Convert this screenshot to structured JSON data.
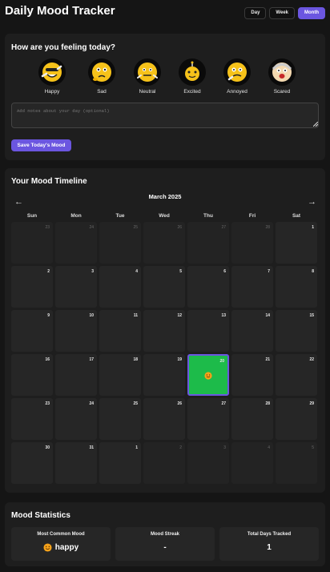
{
  "header": {
    "title": "Daily Mood Tracker",
    "views": [
      {
        "label": "Day",
        "active": false
      },
      {
        "label": "Week",
        "active": false
      },
      {
        "label": "Month",
        "active": true
      }
    ]
  },
  "entry": {
    "title": "How are you feeling today?",
    "moods": [
      {
        "label": "Happy",
        "icon": "happy-face-icon"
      },
      {
        "label": "Sad",
        "icon": "sad-face-icon"
      },
      {
        "label": "Neutral",
        "icon": "neutral-face-icon"
      },
      {
        "label": "Excited",
        "icon": "excited-face-icon"
      },
      {
        "label": "Annoyed",
        "icon": "annoyed-face-icon"
      },
      {
        "label": "Scared",
        "icon": "scared-face-icon"
      }
    ],
    "notes_placeholder": "Add notes about your day (optional)",
    "save_label": "Save Today's Mood"
  },
  "timeline": {
    "title": "Your Mood Timeline",
    "month": "March 2025",
    "prev_arrow": "←",
    "next_arrow": "→",
    "weekdays": [
      "Sun",
      "Mon",
      "Tue",
      "Wed",
      "Thu",
      "Fri",
      "Sat"
    ],
    "days": [
      "23",
      "24",
      "25",
      "26",
      "27",
      "28",
      "1",
      "2",
      "3",
      "4",
      "5",
      "6",
      "7",
      "8",
      "9",
      "10",
      "11",
      "12",
      "13",
      "14",
      "15",
      "16",
      "17",
      "18",
      "19",
      "20",
      "21",
      "22",
      "23",
      "24",
      "25",
      "26",
      "27",
      "28",
      "29",
      "30",
      "31",
      "1",
      "2",
      "3",
      "4",
      "5"
    ],
    "today_index": 25,
    "today_mood": "happy",
    "colors": {
      "today_bg": "#1dbb4a",
      "accent": "#6b56e0"
    }
  },
  "stats": {
    "title": "Mood Statistics",
    "items": [
      {
        "title": "Most Common Mood",
        "value": "happy",
        "icon": "happy-face-icon"
      },
      {
        "title": "Mood Streak",
        "value": "-"
      },
      {
        "title": "Total Days Tracked",
        "value": "1"
      }
    ]
  }
}
